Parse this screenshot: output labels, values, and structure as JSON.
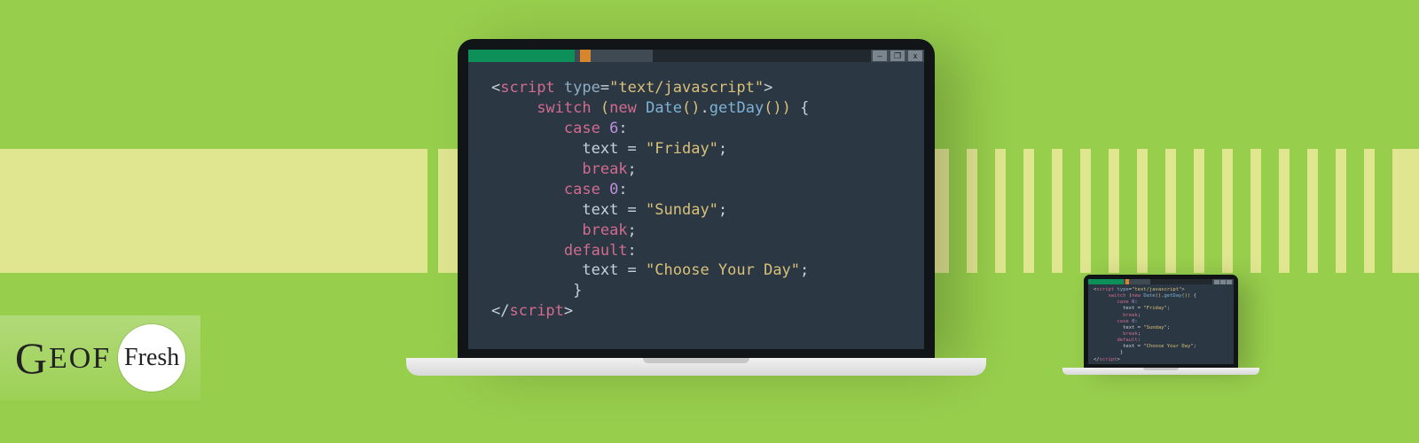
{
  "logo": {
    "part1_first": "G",
    "part1_rest": "EOF",
    "part2": "Fresh"
  },
  "window_buttons": {
    "min": "–",
    "max": "❐",
    "close": "x"
  },
  "code": {
    "script_open_angle": "<",
    "script_tag": "script",
    "type_attr": "type",
    "eq": "=",
    "type_val": "\"text/javascript\"",
    "close_angle": ">",
    "switch_kw": "switch",
    "paren_open": "(",
    "new_kw": "new",
    "date_cls": "Date",
    "empty_call": "()",
    "dot": ".",
    "getday": "getDay",
    "call_close": "())",
    "brace_open": " {",
    "case_kw": "case",
    "six": "6",
    "colon": ":",
    "text_ident": "text",
    "assign": " = ",
    "friday": "\"Friday\"",
    "semicolon": ";",
    "break_kw": "break",
    "zero": "0",
    "sunday": "\"Sunday\"",
    "default_kw": "default",
    "choose": "\"Choose Your Day\"",
    "brace_close": "}",
    "script_close_open": "</",
    "sp2": "     ",
    "sp3": "        ",
    "sp4": "          ",
    "sp35": "         "
  }
}
